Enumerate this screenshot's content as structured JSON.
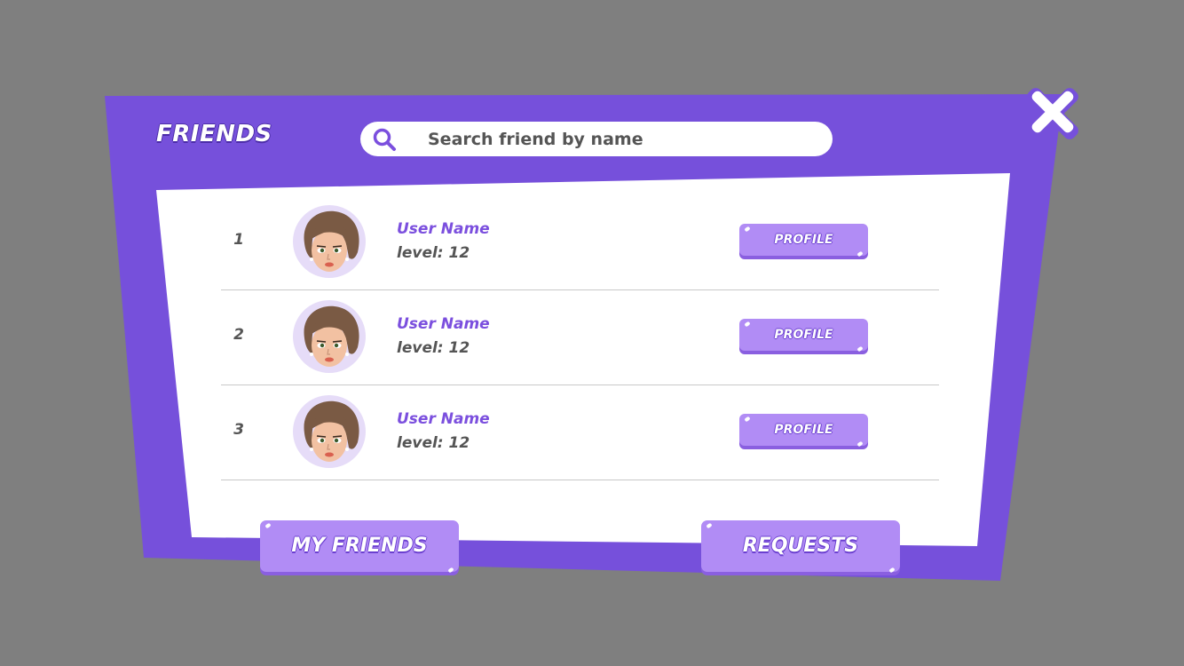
{
  "title": "FRIENDS",
  "search": {
    "placeholder": "Search friend by name",
    "icon": "search-icon"
  },
  "colors": {
    "background": "#7f7f7f",
    "panel": "#7650db",
    "panel_inner": "#ffffff",
    "accent_text": "#7b4fde",
    "button_face": "#b18cf5",
    "button_shadow": "#8a5fe0",
    "body_text": "#555555"
  },
  "friends": [
    {
      "rank": "1",
      "name": "User Name",
      "level_label": "level:",
      "level": "12",
      "button": "PROFILE"
    },
    {
      "rank": "2",
      "name": "User Name",
      "level_label": "level:",
      "level": "12",
      "button": "PROFILE"
    },
    {
      "rank": "3",
      "name": "User Name",
      "level_label": "level:",
      "level": "12",
      "button": "PROFILE"
    }
  ],
  "footer": {
    "my_friends": "MY FRIENDS",
    "requests": "REQUESTS"
  },
  "close_icon": "close-icon"
}
